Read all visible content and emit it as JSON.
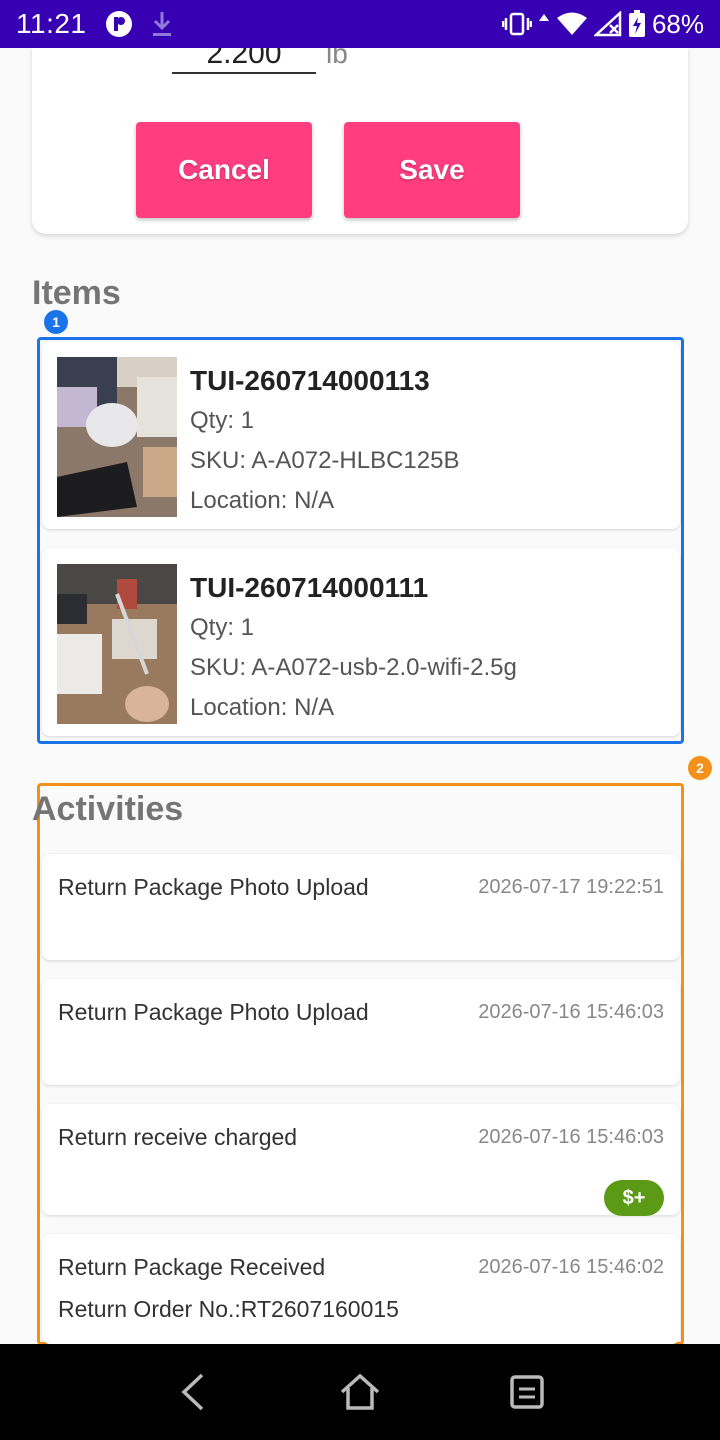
{
  "status_bar": {
    "time": "11:21",
    "battery": "68%",
    "network_badge": "5"
  },
  "form": {
    "weight_value": "2.200",
    "weight_unit": "lb",
    "cancel_label": "Cancel",
    "save_label": "Save"
  },
  "items_section": {
    "title": "Items",
    "marker": "1",
    "items": [
      {
        "id": "TUI-260714000113",
        "qty": "Qty: 1",
        "sku": "SKU: A-A072-HLBC125B",
        "location": "Location: N/A"
      },
      {
        "id": "TUI-260714000111",
        "qty": "Qty: 1",
        "sku": "SKU: A-A072-usb-2.0-wifi-2.5g",
        "location": "Location: N/A"
      }
    ]
  },
  "activities_section": {
    "title": "Activities",
    "marker": "2",
    "entries": [
      {
        "title": "Return Package Photo Upload",
        "time": "2026-07-17 19:22:51"
      },
      {
        "title": "Return Package Photo Upload",
        "time": "2026-07-16 15:46:03"
      },
      {
        "title": "Return receive charged",
        "time": "2026-07-16 15:46:03",
        "badge": "$+"
      },
      {
        "title": "Return Package Received",
        "time": "2026-07-16 15:46:02",
        "subtitle": "Return Order No.:RT2607160015"
      }
    ]
  },
  "colors": {
    "status_bar": "#3700b3",
    "button": "#ff3d7f",
    "marker_blue": "#1a73e8",
    "marker_orange": "#f39019",
    "badge_green": "#5a9a14"
  },
  "nav": {
    "back": "back-icon",
    "home": "home-icon",
    "recents": "recents-icon"
  }
}
